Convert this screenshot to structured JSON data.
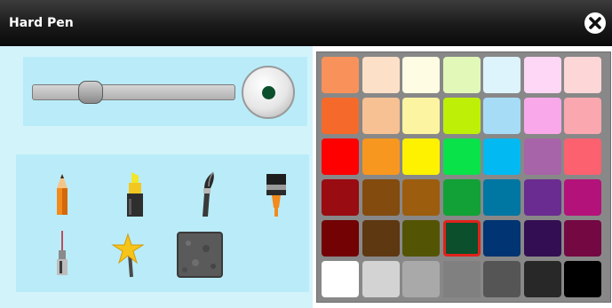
{
  "window": {
    "title": "Hard Pen"
  },
  "icons": {
    "close": "close-icon",
    "tools": [
      "pencil-icon",
      "highlighter-icon",
      "paintbrush-icon",
      "wide-brush-icon",
      "fountain-pen-icon",
      "star-wand-icon",
      "texture-icon"
    ]
  },
  "brush_size": {
    "slider_value": 0.29,
    "preview_color": "#0b4f2c"
  },
  "tools": [
    {
      "id": "pencil",
      "selected": false
    },
    {
      "id": "highlighter",
      "selected": false
    },
    {
      "id": "paintbrush",
      "selected": false
    },
    {
      "id": "wide-brush",
      "selected": false
    },
    {
      "id": "fountain-pen",
      "selected": false
    },
    {
      "id": "star-wand",
      "selected": true
    },
    {
      "id": "texture",
      "selected": false
    }
  ],
  "palette": {
    "selected_color": "#0b4f2c",
    "rows": [
      [
        "#f9925a",
        "#fde0c8",
        "#fefce2",
        "#e2f8b9",
        "#ddf4fd",
        "#fdd7f5",
        "#fdd6d8"
      ],
      [
        "#f56a2b",
        "#f7c193",
        "#fdf4a1",
        "#bef007",
        "#a7dcf7",
        "#f9a8ea",
        "#fba7b0"
      ],
      [
        "#fe0000",
        "#f79720",
        "#fff200",
        "#0ae24a",
        "#02b9f1",
        "#a864a8",
        "#fc6170"
      ],
      [
        "#990c12",
        "#834b0e",
        "#9c5d0f",
        "#12a136",
        "#0076a3",
        "#6a2c91",
        "#b3127a"
      ],
      [
        "#720203",
        "#5e3811",
        "#545405",
        "#0b4f2c",
        "#003472",
        "#330e52",
        "#740843"
      ],
      [
        "#ffffff",
        "#d3d3d3",
        "#a9a9a9",
        "#808080",
        "#555555",
        "#282828",
        "#000000"
      ]
    ]
  }
}
